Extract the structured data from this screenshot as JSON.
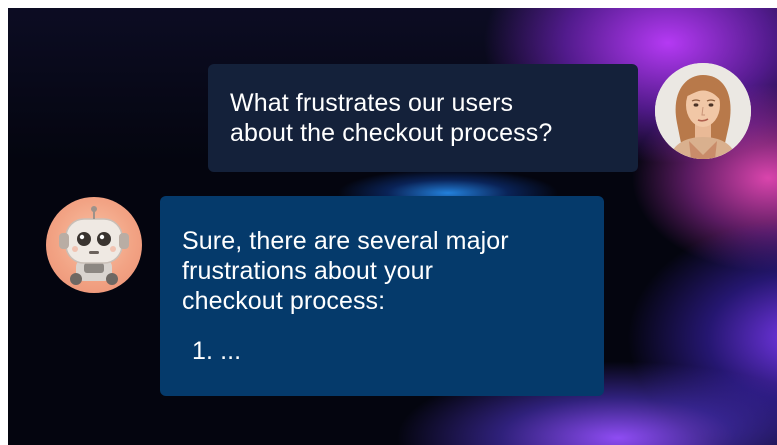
{
  "conversation": {
    "user_message": {
      "avatar_icon": "woman-portrait-avatar",
      "lines": [
        "What frustrates our users",
        "about the checkout process?"
      ]
    },
    "assistant_message": {
      "avatar_icon": "robot-avatar",
      "lines": [
        "Sure, there are several major",
        "frustrations about your",
        "checkout process:"
      ],
      "list_item": "1. ..."
    }
  },
  "colors": {
    "background": "#04050f",
    "user_bubble": "#14213a",
    "assistant_bubble": "#053a6b",
    "text": "#ffffff"
  }
}
